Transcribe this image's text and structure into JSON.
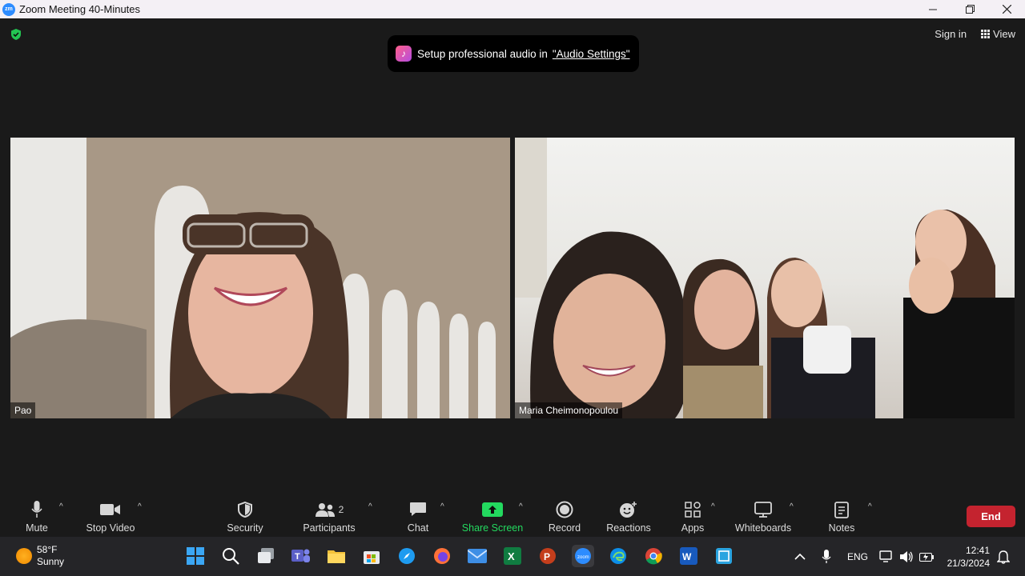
{
  "window": {
    "title": "Zoom Meeting 40-Minutes",
    "app_icon_text": "zm"
  },
  "toast": {
    "message": "Setup professional audio in",
    "link": "\"Audio Settings\""
  },
  "top_right": {
    "sign_in": "Sign in",
    "view": "View"
  },
  "participants_tiles": [
    {
      "name": "Pao"
    },
    {
      "name": "Maria Cheimonopoulou"
    }
  ],
  "toolbar": {
    "mute": "Mute",
    "stop_video": "Stop Video",
    "security": "Security",
    "participants": "Participants",
    "participants_count": "2",
    "chat": "Chat",
    "share_screen": "Share Screen",
    "record": "Record",
    "reactions": "Reactions",
    "apps": "Apps",
    "whiteboards": "Whiteboards",
    "notes": "Notes",
    "end": "End"
  },
  "taskbar": {
    "weather_temp": "58°F",
    "weather_desc": "Sunny",
    "language": "ENG",
    "time": "12:41",
    "date": "21/3/2024"
  },
  "colors": {
    "share_green": "#23d95f",
    "end_red": "#c4232f",
    "zoom_blue": "#2d8cff"
  }
}
